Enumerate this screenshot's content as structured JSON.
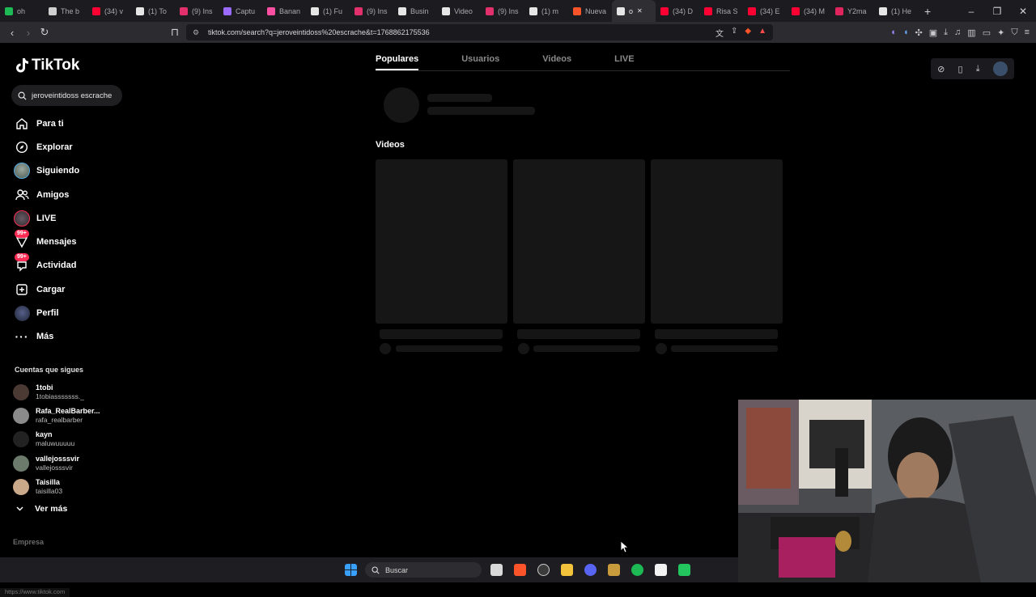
{
  "browser": {
    "tabs": [
      {
        "title": "oh",
        "color": "#1db954"
      },
      {
        "title": "The b",
        "color": "#cfcfcf"
      },
      {
        "title": "(34) v",
        "color": "#ff0033"
      },
      {
        "title": "(1) To",
        "color": "#e6e6e6"
      },
      {
        "title": "(9) Ins",
        "color": "#e1306c"
      },
      {
        "title": "Captu",
        "color": "#9b6bff"
      },
      {
        "title": "Banan",
        "color": "#ff4fa3"
      },
      {
        "title": "(1) Fu",
        "color": "#e6e6e6"
      },
      {
        "title": "(9) Ins",
        "color": "#e1306c"
      },
      {
        "title": "Busin",
        "color": "#e6e6e6"
      },
      {
        "title": "Video",
        "color": "#e6e6e6"
      },
      {
        "title": "(9) Ins",
        "color": "#e1306c"
      },
      {
        "title": "(1) m",
        "color": "#e6e6e6"
      },
      {
        "title": "Nueva",
        "color": "#fb542b"
      },
      {
        "title": "o",
        "color": "#e6e6e6",
        "active": true
      },
      {
        "title": "(34) D",
        "color": "#ff0033"
      },
      {
        "title": "Risa S",
        "color": "#ff0033"
      },
      {
        "title": "(34) E",
        "color": "#ff0033"
      },
      {
        "title": "(34) M",
        "color": "#ff0033"
      },
      {
        "title": "Y2ma",
        "color": "#e0245e"
      },
      {
        "title": "(1) He",
        "color": "#e6e6e6"
      }
    ],
    "url": "tiktok.com/search?q=jeroveintidoss%20escrache&t=1768862175536"
  },
  "sidebar": {
    "logo": "TikTok",
    "search_value": "jeroveintidoss escrache",
    "nav": [
      {
        "label": "Para ti",
        "icon": "home-icon"
      },
      {
        "label": "Explorar",
        "icon": "compass-icon"
      },
      {
        "label": "Siguiendo",
        "icon": "avatar"
      },
      {
        "label": "Amigos",
        "icon": "friends-icon"
      },
      {
        "label": "LIVE",
        "icon": "live-icon"
      },
      {
        "label": "Mensajes",
        "icon": "messages-icon",
        "badge": "99+"
      },
      {
        "label": "Actividad",
        "icon": "activity-icon",
        "badge": "99+"
      },
      {
        "label": "Cargar",
        "icon": "upload-icon"
      },
      {
        "label": "Perfil",
        "icon": "profile-icon"
      },
      {
        "label": "Más",
        "icon": "more-icon"
      }
    ],
    "following_title": "Cuentas que sigues",
    "following": [
      {
        "name": "1tobi",
        "handle": "1tobiasssssss._",
        "color": "#4b3a34"
      },
      {
        "name": "Rafa_RealBarber...",
        "handle": "rafa_realbarber",
        "color": "#8a8a8a"
      },
      {
        "name": "kayn",
        "handle": "maluwuuuuu",
        "color": "#222"
      },
      {
        "name": "vallejosssvir",
        "handle": "vallejosssvir",
        "color": "#6b7a6a"
      },
      {
        "name": "Taisilla",
        "handle": "taisilla03",
        "color": "#c9a98a"
      }
    ],
    "see_more": "Ver más",
    "footer_label": "Empresa",
    "status_url": "https://www.tiktok.com"
  },
  "main": {
    "tabs": [
      "Populares",
      "Usuarios",
      "Videos",
      "LIVE"
    ],
    "selected_tab": "Populares",
    "videos_title": "Videos"
  },
  "taskbar": {
    "search_placeholder": "Buscar"
  }
}
